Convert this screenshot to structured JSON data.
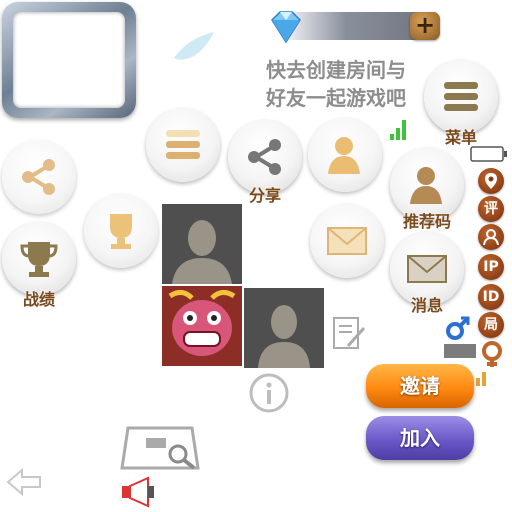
{
  "header": {
    "notice_line1": "快去创建房间与",
    "notice_line2": "好友一起游戏吧",
    "add_gems": "+"
  },
  "buttons": {
    "share": "分享",
    "record": "战绩",
    "menu": "菜单",
    "referral_code": "推荐码",
    "message": "消息",
    "invite": "邀请",
    "join": "加入"
  },
  "side_icons": [
    "评",
    "IP",
    "ID",
    "局"
  ],
  "colors": {
    "invite": "#ff8a10",
    "join": "#6a58c8",
    "side_icon": "#a4461a",
    "wifi": "#3fc33b"
  }
}
